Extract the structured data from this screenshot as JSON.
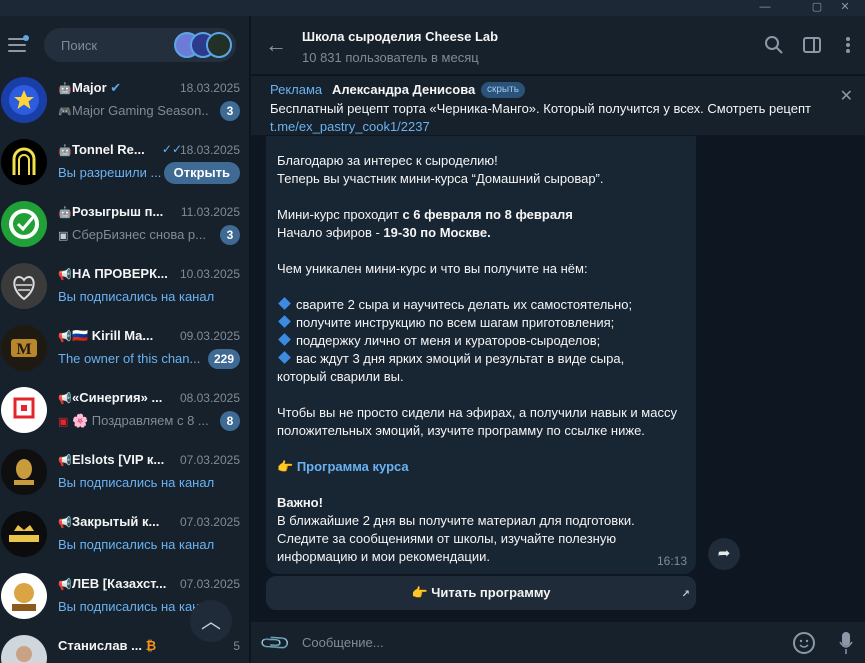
{
  "sidebar": {
    "search_placeholder": "Поиск",
    "chats": [
      {
        "name": "Major",
        "date": "18.03.2025",
        "preview": "Major Gaming Season...",
        "badge": "3",
        "preview_blue": false
      },
      {
        "name": "Tonnel Re...",
        "date": "18.03.2025",
        "preview": "Вы разрешили ...",
        "button": "Открыть",
        "preview_blue": true
      },
      {
        "name": "Розыгрыш п...",
        "date": "11.03.2025",
        "preview": "СберБизнес снова р...",
        "badge": "3",
        "preview_blue": false
      },
      {
        "name": "НА ПРОВЕРК...",
        "date": "10.03.2025",
        "preview": "Вы подписались на канал",
        "preview_blue": true
      },
      {
        "name": "🇷🇺 Kirill Ma...",
        "date": "09.03.2025",
        "preview": "The owner of this chan...",
        "badge": "229",
        "preview_blue": true
      },
      {
        "name": "«Синергия» ...",
        "date": "08.03.2025",
        "preview": "🌸 Поздравляем с 8 ...",
        "badge": "8",
        "preview_blue": false
      },
      {
        "name": "Elslots [VIP к...",
        "date": "07.03.2025",
        "preview": "Вы подписались на канал",
        "preview_blue": true
      },
      {
        "name": "Закрытый к...",
        "date": "07.03.2025",
        "preview": "Вы подписались на канал",
        "preview_blue": true
      },
      {
        "name": "ЛЕВ [Казахст...",
        "date": "07.03.2025",
        "preview": "Вы подписались на канал",
        "preview_blue": true
      },
      {
        "name": "Станислав ...",
        "date": "5",
        "preview": "",
        "preview_blue": false
      }
    ]
  },
  "header": {
    "title": "Школа сыроделия Cheese Lab",
    "subtitle": "10 831 пользователь в месяц"
  },
  "ad": {
    "label": "Реклама",
    "author": "Александра Денисова",
    "hide": "скрыть",
    "text": "Бесплатный рецепт торта «Черника-Манго». Который получится у всех. Смотреть рецепт ",
    "link": "t.me/ex_pastry_cook1/2237"
  },
  "message": {
    "l1": "Благодарю за интерес к сыроделию!",
    "l2": "Теперь вы участник мини-курса “Домашний сыровар”.",
    "l3a": "Мини-курс проходит ",
    "l3b": "с  6 февраля по 8 февраля",
    "l4a": "Начало эфиров - ",
    "l4b": "19-30 по Москве.",
    "l5": "Чем уникален мини-курс и что вы получите на нём:",
    "b1": "сварите 2 сыра и научитесь делать их самостоятельно;",
    "b2": "получите инструкцию по всем шагам приготовления;",
    "b3": "поддержку лично от меня и кураторов-сыроделов;",
    "b4": "вас ждут 3 дня ярких эмоций и результат в виде сыра,",
    "b4b": "который сварили вы.",
    "p1": "Чтобы вы не просто сидели на эфирах, а получили навык и массу",
    "p2": "положительных эмоций, изучите программу по ссылке ниже.",
    "link_emoji": "👉",
    "link": "Программа курса",
    "important": "Важно!",
    "i1": "В ближайшие 2 дня вы получите материал для подготовки.",
    "i2": "Следите за сообщениями от школы, изучайте полезную",
    "i3": "информацию и мои рекомендации.",
    "time": "16:13"
  },
  "inline_button": "👉 Читать программу",
  "composer_placeholder": "Сообщение..."
}
